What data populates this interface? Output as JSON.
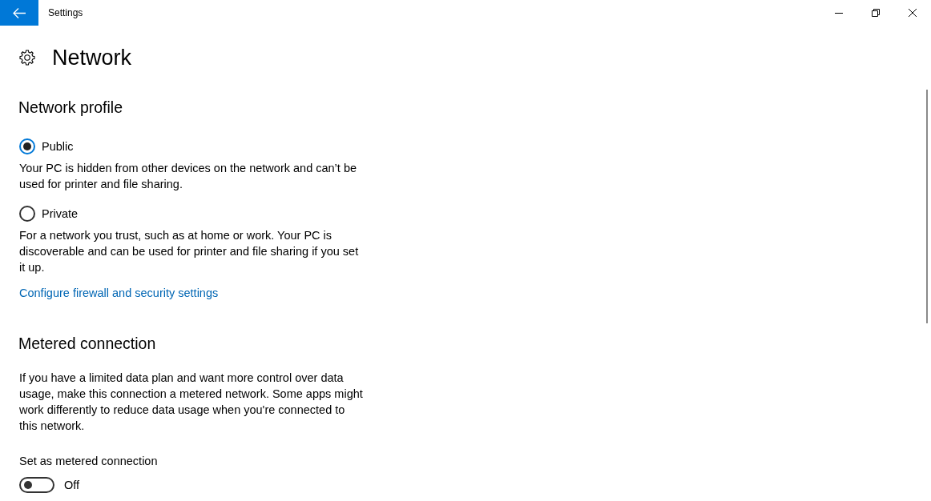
{
  "window": {
    "title": "Settings"
  },
  "page": {
    "title": "Network"
  },
  "sections": [
    {
      "kind": "radio_group",
      "heading": "Network profile",
      "options": [
        {
          "label": "Public",
          "selected": true,
          "description": "Your PC is hidden from other devices on the network and can’t be used for printer and file sharing."
        },
        {
          "label": "Private",
          "selected": false,
          "description": "For a network you trust, such as at home or work. Your PC is discoverable and can be used for printer and file sharing if you set it up."
        }
      ],
      "link": "Configure firewall and security settings"
    },
    {
      "kind": "toggle",
      "heading": "Metered connection",
      "description": "If you have a limited data plan and want more control over data usage, make this connection a metered network. Some apps might work differently to reduce data usage when you're connected to this network.",
      "setting_label": "Set as metered connection",
      "toggle": {
        "on": false,
        "state_label": "Off"
      }
    }
  ]
}
